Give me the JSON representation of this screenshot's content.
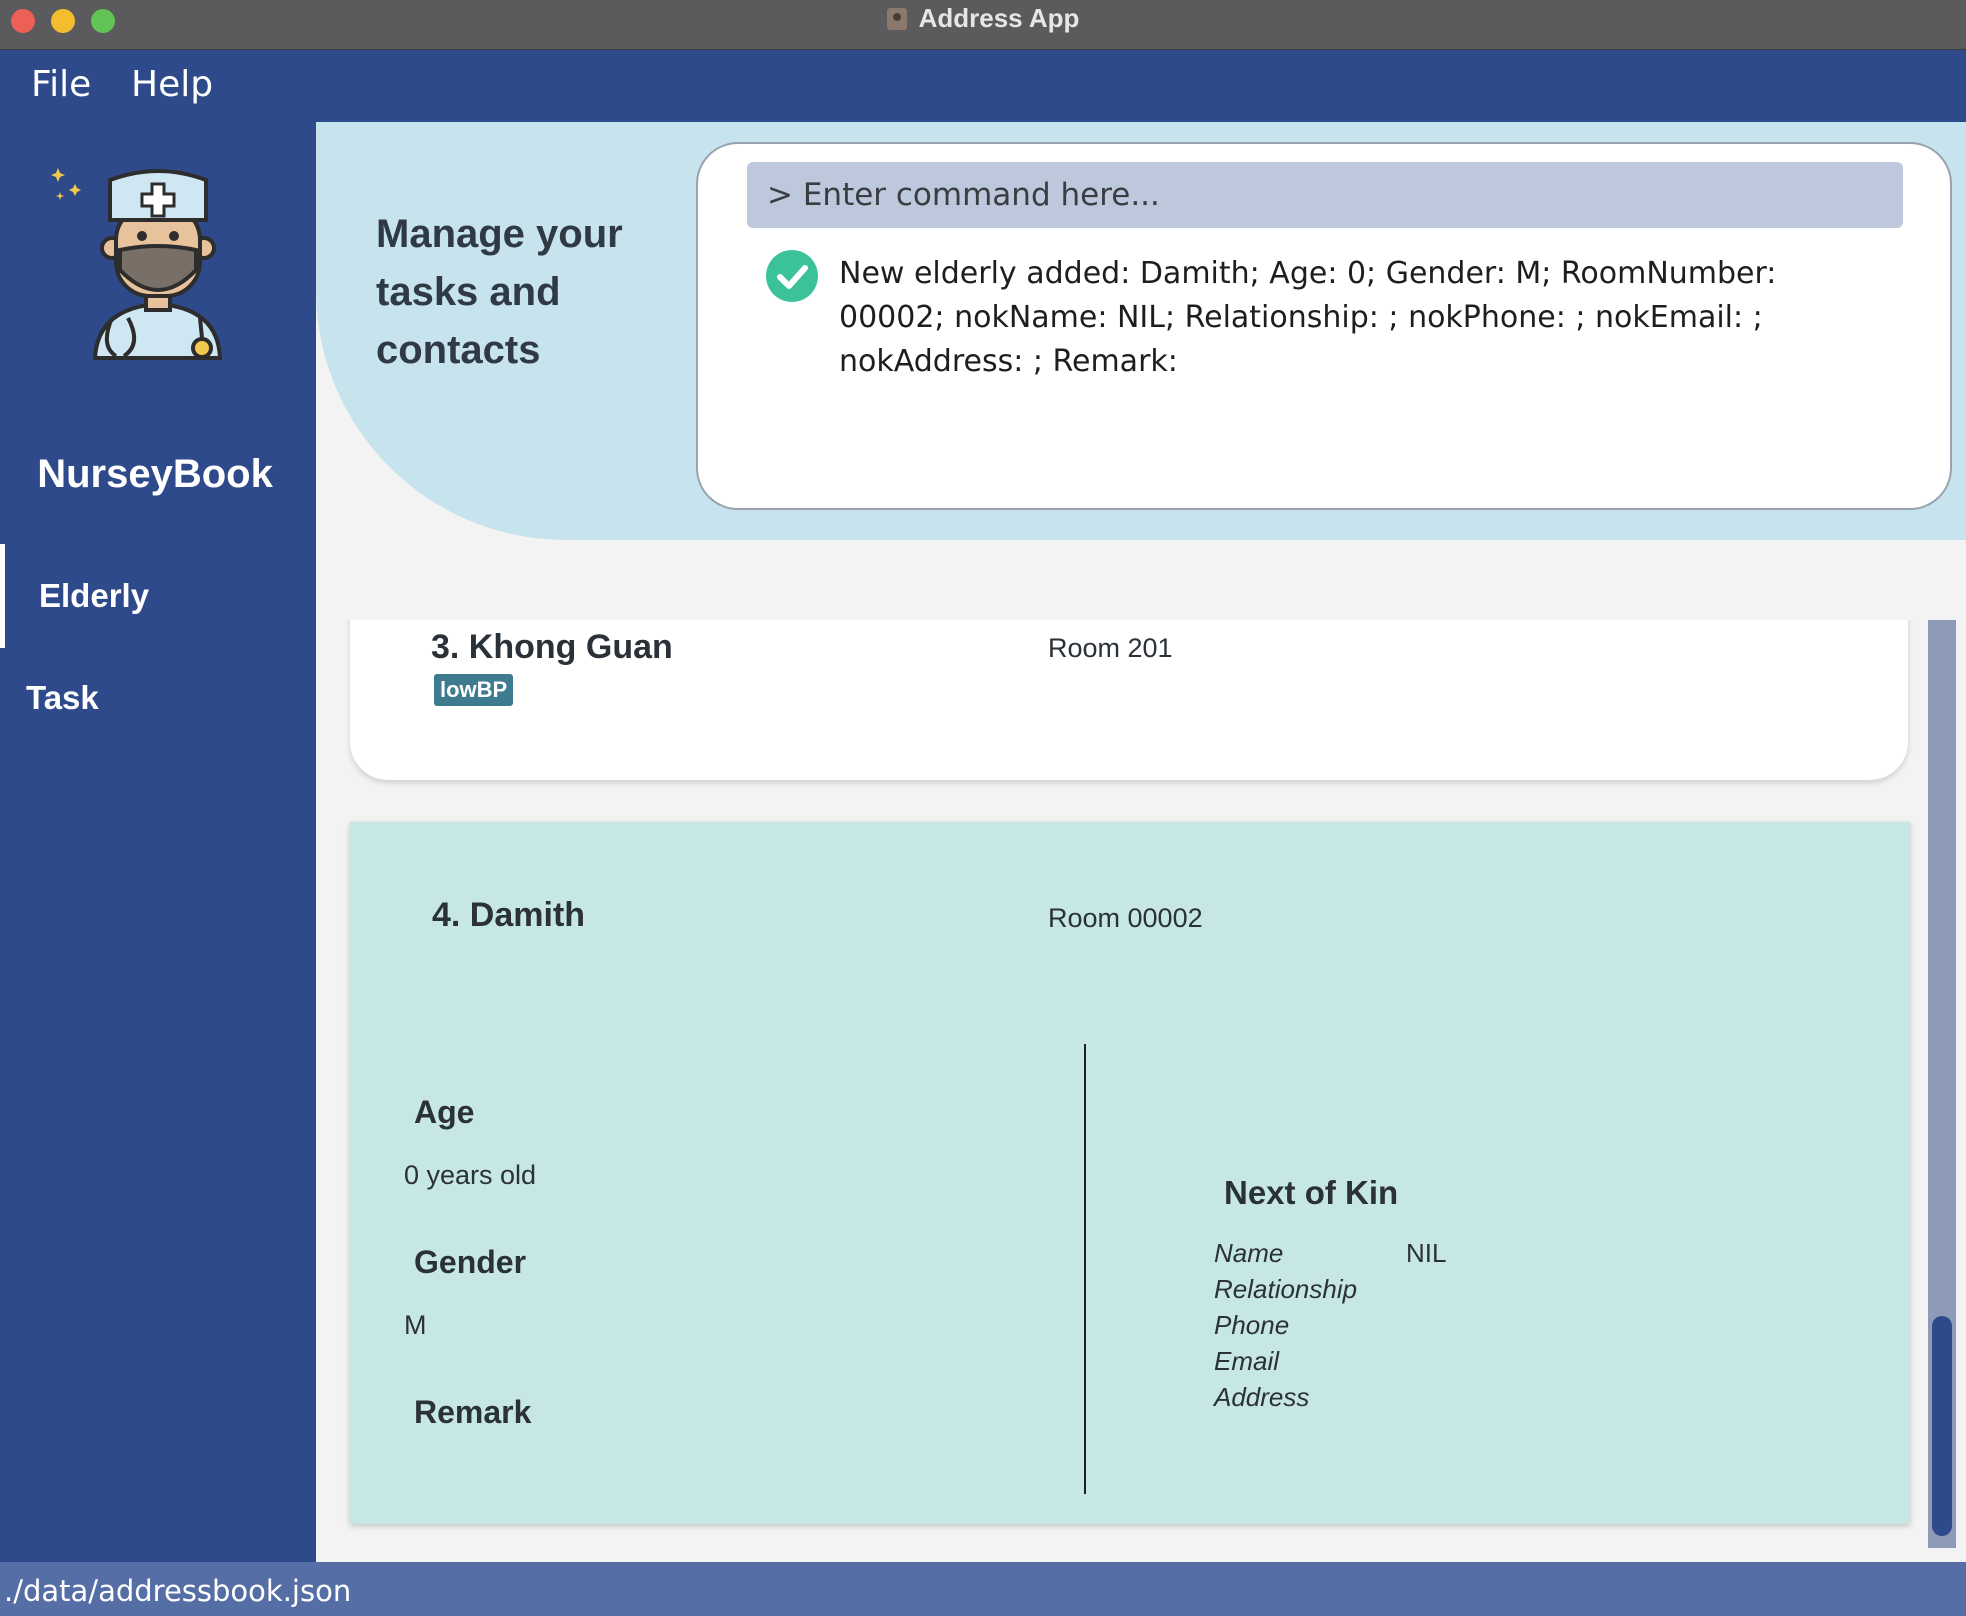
{
  "window": {
    "title": "Address App"
  },
  "menu": {
    "file": "File",
    "help": "Help"
  },
  "sidebar": {
    "brand": "NurseyBook",
    "items": [
      {
        "label": "Elderly",
        "active": true
      },
      {
        "label": "Task",
        "active": false
      }
    ]
  },
  "header": {
    "tagline": "Manage your tasks and contacts"
  },
  "command": {
    "placeholder": "> Enter command here...",
    "value": "",
    "result": "New elderly added: Damith; Age: 0; Gender: M; RoomNumber: 00002; nokName: NIL; Relationship: ; nokPhone: ; nokEmail: ; nokAddress: ; Remark:",
    "status_icon": "check-circle-icon",
    "status_color": "#3cc29a"
  },
  "elderly_list": [
    {
      "index_name": "3. Khong Guan",
      "room": "Room 201",
      "tags": [
        "lowBP"
      ]
    },
    {
      "index_name": "4. Damith",
      "room": "Room 00002",
      "details": {
        "age_title": "Age",
        "age_value": "0 years old",
        "gender_title": "Gender",
        "gender_value": "M",
        "remark_title": "Remark",
        "remark_value": "",
        "nok_title": "Next of Kin",
        "nok_fields": [
          {
            "label": "Name",
            "value": "NIL"
          },
          {
            "label": "Relationship",
            "value": ""
          },
          {
            "label": "Phone",
            "value": ""
          },
          {
            "label": "Email",
            "value": ""
          },
          {
            "label": "Address",
            "value": ""
          }
        ]
      }
    }
  ],
  "statusbar": {
    "path": "./data/addressbook.json"
  },
  "colors": {
    "primary": "#2e4a8a",
    "header_band": "#c7e3ee",
    "selected_card": "#c7e7e5",
    "tag": "#3e7b91"
  }
}
